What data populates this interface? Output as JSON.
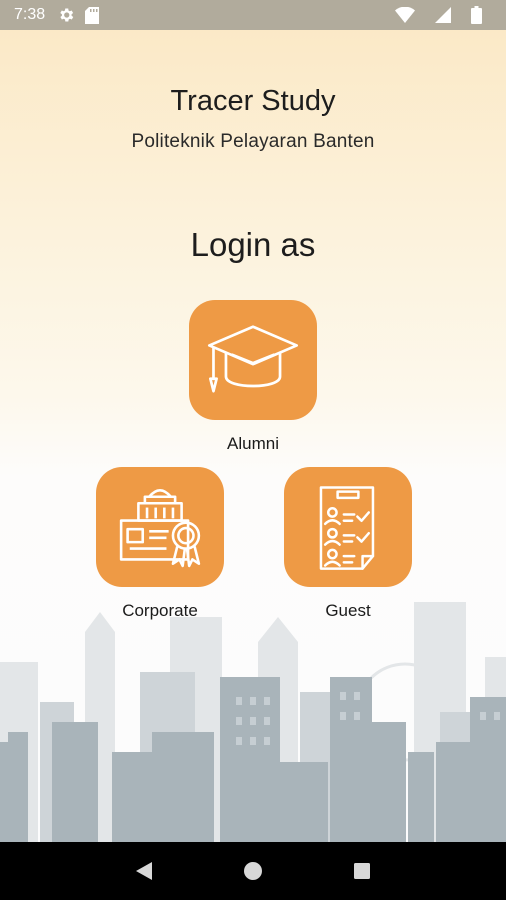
{
  "status_bar": {
    "time": "7:38",
    "icons": [
      "gear-icon",
      "sd-card-icon",
      "wifi-icon",
      "signal-icon",
      "battery-icon"
    ]
  },
  "header": {
    "title": "Tracer Study",
    "subtitle": "Politeknik Pelayaran Banten"
  },
  "login": {
    "heading": "Login as",
    "options": [
      {
        "label": "Alumni",
        "icon": "graduation-cap-icon"
      },
      {
        "label": "Corporate",
        "icon": "corporate-certificate-icon"
      },
      {
        "label": "Guest",
        "icon": "guest-checklist-icon"
      }
    ]
  },
  "nav_bar": {
    "buttons": [
      "back-icon",
      "home-icon",
      "recents-icon"
    ]
  },
  "colors": {
    "accent": "#EE9A45",
    "status_bar": "#B1AB9C",
    "skyline": "#A9B4BA"
  }
}
